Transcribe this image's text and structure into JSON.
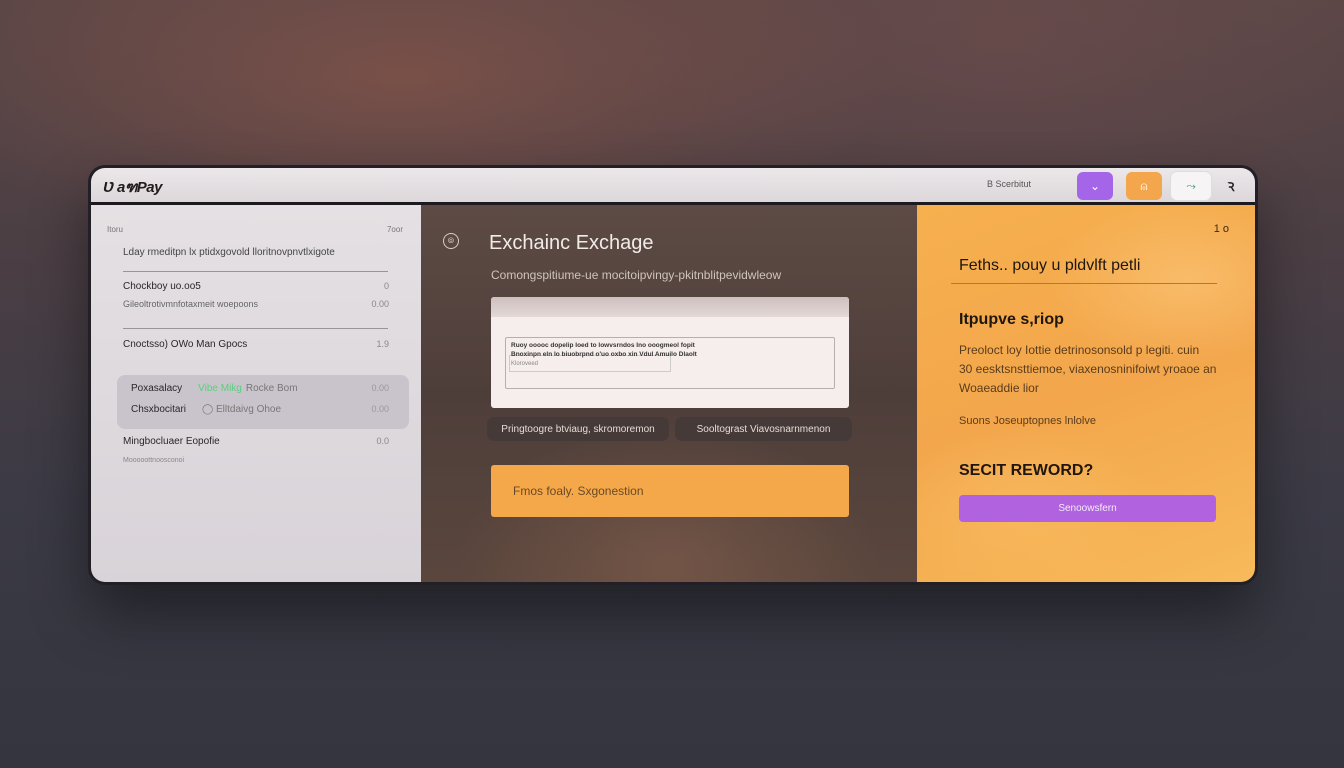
{
  "app": {
    "logo": "Ʋ aฑPay",
    "status": "B Scerbitut"
  },
  "toolbar": {
    "purple_icon": "⌄",
    "orange_icon": "⍝",
    "white_icon": "⤳",
    "user_icon": "Ꝛ"
  },
  "sidebar": {
    "header_left": "Itoru",
    "header_right": "7oor",
    "subtitle": "Lday rmeditpn lx ptidxgovold lloritnovpnvtlxigote",
    "row1": {
      "label": "Chockboy uo.oo5",
      "value": "0"
    },
    "row2": {
      "label": "Gileoltrotivmnfotaxmeit woepoons",
      "value": "0.00"
    },
    "row3": {
      "label": "Cnoctsso) OWo Man Gpocs",
      "value": "1.9"
    },
    "highlight_row1": {
      "label": "Poxasalacy",
      "mid": "Vibe Mikg",
      "mid2": "Rocke Bom",
      "value": "0.00"
    },
    "highlight_row2": {
      "label": "Chsxbocitari",
      "mid": "◯ Elltdaivg Ohoe",
      "value": "0.00"
    },
    "row4": {
      "label": "Mingbocluaer Eopofie",
      "value": "0.0"
    },
    "footer": "Mooooottnoosconoi"
  },
  "main": {
    "icon": "⦾",
    "title": "Exchainc Exchage",
    "subtitle": "Comongspitiume-ue mocitoipvingy-pkitnblitpevidwleow",
    "doc": {
      "line1": "Ruoy ooooc dopelip Ioed to lowvsrndos Ino ooogmeol fopit",
      "line2": "Bnoxinpn eln Io biuobrpnd o'uo oxbo xin Vdul Amuilo Dlaolt",
      "line3": "Kloroveed"
    },
    "button1": "Pringtoogre btviaug, skromoremon",
    "button2": "Sooltograst Viavosnarnmenon",
    "cta": "Fmos foaly. Sxgonestion"
  },
  "right": {
    "corner": "1 o",
    "title": "Feths.. pouy u pldvlft petli",
    "heading": "Itpupve s,riop",
    "p1": "Preoloct loy Iottie detrinosonsold p legiti. cuin",
    "p2": "30 eesktsnsttiemoe, viaxenosninifoiwt yroaoe an",
    "p3": "Woaeaddie lior",
    "note": "Suons Joseuptopnes lnlolve",
    "heading2": "SECIT REWORD?",
    "button": "Senoowsfern"
  }
}
